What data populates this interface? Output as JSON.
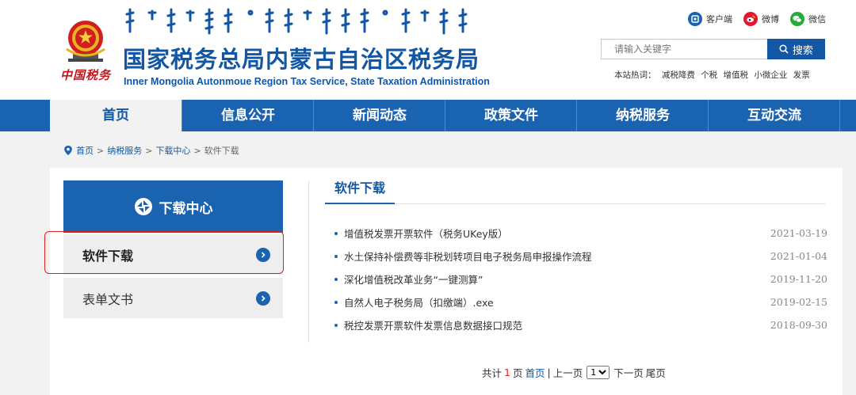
{
  "header": {
    "title": "国家税务总局内蒙古自治区税务局",
    "subtitle": "Inner Mongolia Autonmoue Region Tax Service, State Taxation Administration",
    "calligraphy": "中国税务",
    "top_links": [
      {
        "label": "客户端",
        "icon": "client-icon",
        "color": "#1a63b0"
      },
      {
        "label": "微博",
        "icon": "weibo-icon",
        "color": "#e6162d"
      },
      {
        "label": "微信",
        "icon": "wechat-icon",
        "color": "#22ac38"
      }
    ],
    "search": {
      "placeholder": "请输入关键字",
      "button_label": "搜索"
    },
    "hot": {
      "label": "本站热词：",
      "words": [
        "减税降费",
        "个税",
        "增值税",
        "小微企业",
        "发票"
      ]
    }
  },
  "nav": {
    "items": [
      "首页",
      "信息公开",
      "新闻动态",
      "政策文件",
      "纳税服务",
      "互动交流"
    ],
    "active_index": 0
  },
  "breadcrumb": [
    "首页",
    "纳税服务",
    "下载中心",
    "软件下载"
  ],
  "sidebar": {
    "title": "下载中心",
    "items": [
      {
        "label": "软件下载",
        "active": true
      },
      {
        "label": "表单文书",
        "active": false
      }
    ]
  },
  "main": {
    "section_title": "软件下载",
    "items": [
      {
        "title": "增值税发票开票软件（税务UKey版）",
        "date": "2021-03-19"
      },
      {
        "title": "水土保持补偿费等非税划转项目电子税务局申报操作流程",
        "date": "2021-01-04"
      },
      {
        "title": "深化增值税改革业务“一键测算”",
        "date": "2019-11-20"
      },
      {
        "title": "自然人电子税务局（扣缴端）.exe",
        "date": "2019-02-15"
      },
      {
        "title": "税控发票开票软件发票信息数据接口规范",
        "date": "2018-09-30"
      }
    ]
  },
  "pagination": {
    "total_prefix": "共计",
    "total_pages": "1",
    "total_suffix": "页",
    "first": "首页",
    "prev": "上一页",
    "select_value": "1",
    "next": "下一页",
    "last": "尾页"
  },
  "colors": {
    "primary": "#1a63b0",
    "title_blue": "#1157a6",
    "highlight_red": "#e02020"
  }
}
